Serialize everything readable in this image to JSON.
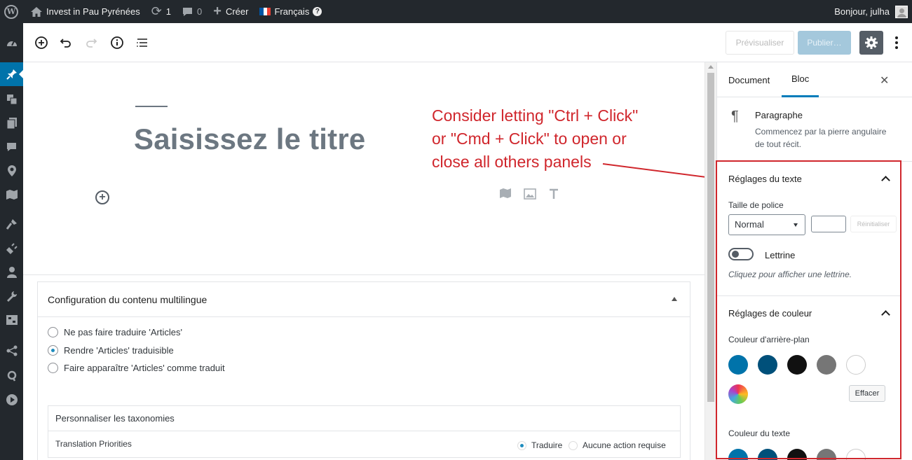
{
  "adminbar": {
    "site_name": "Invest in Pau Pyrénées",
    "updates_count": "1",
    "comments_count": "0",
    "new_label": "Créer",
    "language_label": "Français",
    "greeting": "Bonjour, julha"
  },
  "toolbar": {
    "preview_label": "Prévisualiser",
    "publish_label": "Publier…"
  },
  "editor": {
    "title_placeholder": "Saisissez le titre"
  },
  "annotation": {
    "line1": "Consider letting \"Ctrl + Click\"",
    "line2": "or \"Cmd + Click\" to open or",
    "line3": "close all others panels"
  },
  "metabox": {
    "title": "Configuration du contenu multilingue",
    "options": [
      "Ne pas faire traduire 'Articles'",
      "Rendre 'Articles' traduisible",
      "Faire apparaître 'Articles' comme traduit"
    ],
    "selected_index": 1,
    "taxonomies_title": "Personnaliser les taxonomies",
    "taxonomy_row_label": "Translation Priorities",
    "taxonomy_options": [
      "Traduire",
      "Aucune action requise"
    ]
  },
  "sidebar": {
    "tab_document": "Document",
    "tab_block": "Bloc",
    "block_name": "Paragraphe",
    "block_description": "Commencez par la pierre angulaire de tout récit.",
    "text_settings": {
      "title": "Réglages du texte",
      "font_size_label": "Taille de police",
      "font_size_value": "Normal",
      "reset_label": "Réinitialiser",
      "dropcap_label": "Lettrine",
      "dropcap_help": "Cliquez pour afficher une lettrine."
    },
    "color_settings": {
      "title": "Réglages de couleur",
      "background_label": "Couleur d'arrière-plan",
      "clear_label": "Effacer",
      "text_color_label": "Couleur du texte"
    }
  },
  "colors": {
    "palette": [
      "#0073aa",
      "#00507a",
      "#111111",
      "#767676",
      "#ffffff"
    ],
    "annotation": "#d0262c"
  }
}
